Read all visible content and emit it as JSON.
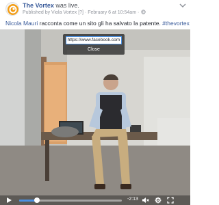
{
  "post": {
    "page_name": "The Vortex",
    "action": "was live.",
    "published_by": "Published by Viola Vortex [?] · February 6 at 10:54am ·",
    "text_person": "Nicola Mauri",
    "text_body": " racconta come un sito gli ha salvato la patente. ",
    "hashtag": "#thevortex"
  },
  "popup": {
    "url": "https://www.facebook.com",
    "close_label": "Close"
  },
  "controls": {
    "time_remaining": "-2:13",
    "progress_fraction": 0.17
  },
  "icons": {
    "avatar": "vortex-logo-icon",
    "privacy": "globe-icon",
    "menu": "chevron-down-icon",
    "play": "play-icon",
    "mute": "mute-icon",
    "settings": "gear-icon",
    "fullscreen": "fullscreen-icon"
  },
  "colors": {
    "link": "#365899",
    "progress": "#4a90e2"
  }
}
